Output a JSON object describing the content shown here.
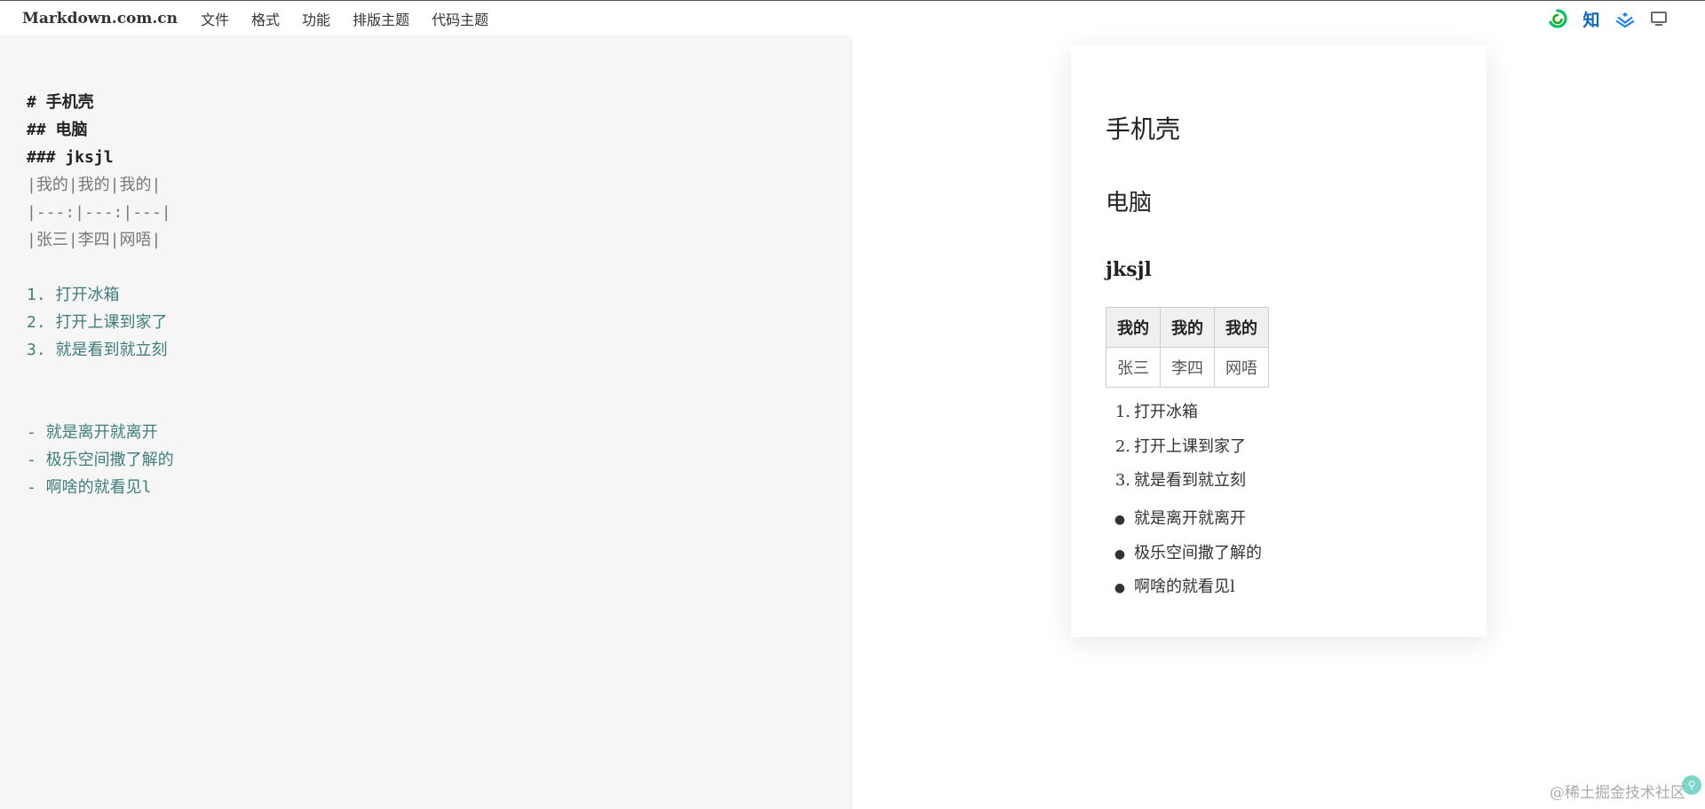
{
  "topbar": {
    "brand": "Markdown.com.cn",
    "menu": [
      "文件",
      "格式",
      "功能",
      "排版主题",
      "代码主题"
    ],
    "icons": {
      "wechat": "wechat-icon",
      "zhihu": "知",
      "juejin": "juejin-icon",
      "monitor": "monitor-icon"
    }
  },
  "editor": {
    "lines": [
      {
        "text": "# 手机壳",
        "kind": "heading"
      },
      {
        "text": "## 电脑",
        "kind": "heading"
      },
      {
        "text": "### jksjl",
        "kind": "heading"
      },
      {
        "text": "|我的|我的|我的|",
        "kind": "table"
      },
      {
        "text": "|---:|---:|---|",
        "kind": "table"
      },
      {
        "text": "|张三|李四|网唔|",
        "kind": "table"
      },
      {
        "text": "",
        "kind": "blank"
      },
      {
        "text": "1. 打开冰箱",
        "kind": "list"
      },
      {
        "text": "2. 打开上课到家了",
        "kind": "list"
      },
      {
        "text": "3. 就是看到就立刻",
        "kind": "list"
      },
      {
        "text": "",
        "kind": "blank"
      },
      {
        "text": "",
        "kind": "blank"
      },
      {
        "text": "- 就是离开就离开",
        "kind": "list"
      },
      {
        "text": "- 极乐空间撒了解的",
        "kind": "list"
      },
      {
        "text": "- 啊啥的就看见l",
        "kind": "list"
      }
    ]
  },
  "preview": {
    "h1": "手机壳",
    "h2": "电脑",
    "h3": "jksjl",
    "table": {
      "headers": [
        "我的",
        "我的",
        "我的"
      ],
      "rows": [
        [
          "张三",
          "李四",
          "网唔"
        ]
      ]
    },
    "ordered": [
      "打开冰箱",
      "打开上课到家了",
      "就是看到就立刻"
    ],
    "ordered_nums": [
      "1.",
      "2.",
      "3."
    ],
    "unordered": [
      "就是离开就离开",
      "极乐空间撒了解的",
      "啊啥的就看见l"
    ]
  },
  "watermark": "@稀土掘金技术社区",
  "colors": {
    "editor_bg": "#f6f6f6",
    "list_text": "#3f7d7d",
    "table_text": "#777777",
    "wechat_green": "#07c160",
    "zhihu_blue": "#0a66c2",
    "juejin_blue": "#1e80ff"
  }
}
